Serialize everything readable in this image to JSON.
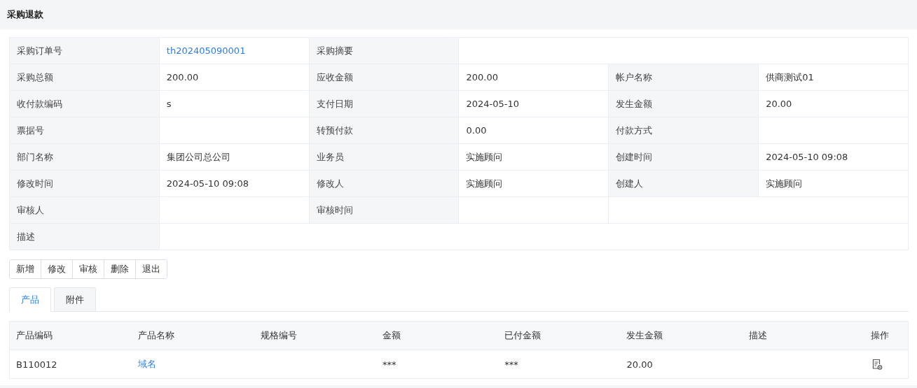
{
  "page": {
    "title": "采购退款"
  },
  "details": [
    [
      {
        "kind": "label",
        "text": "采购订单号"
      },
      {
        "kind": "link",
        "text": "th202405090001"
      },
      {
        "kind": "label",
        "text": "采购摘要"
      },
      {
        "kind": "value"
      }
    ],
    [
      {
        "kind": "label",
        "text": "采购总额"
      },
      {
        "kind": "value",
        "text": "200.00"
      },
      {
        "kind": "label",
        "text": "应收金额"
      },
      {
        "kind": "value",
        "text": "200.00"
      },
      {
        "kind": "label",
        "text": "帐户名称"
      },
      {
        "kind": "value",
        "text": "供商测试01"
      }
    ],
    [
      {
        "kind": "label",
        "text": "收付款编码"
      },
      {
        "kind": "value",
        "text": "s"
      },
      {
        "kind": "label",
        "text": "支付日期"
      },
      {
        "kind": "value",
        "text": "2024-05-10"
      },
      {
        "kind": "label",
        "text": "发生金额"
      },
      {
        "kind": "value",
        "text": "20.00"
      }
    ],
    [
      {
        "kind": "label",
        "text": "票据号"
      },
      {
        "kind": "value"
      },
      {
        "kind": "label",
        "text": "转预付款"
      },
      {
        "kind": "value",
        "text": "0.00"
      },
      {
        "kind": "label",
        "text": "付款方式"
      },
      {
        "kind": "value"
      }
    ],
    [
      {
        "kind": "label",
        "text": "部门名称"
      },
      {
        "kind": "value",
        "text": "集团公司总公司"
      },
      {
        "kind": "label",
        "text": "业务员"
      },
      {
        "kind": "value",
        "text": "实施顾问"
      },
      {
        "kind": "label",
        "text": "创建时间"
      },
      {
        "kind": "value",
        "text": "2024-05-10 09:08"
      }
    ],
    [
      {
        "kind": "label",
        "text": "修改时间"
      },
      {
        "kind": "value",
        "text": "2024-05-10 09:08"
      },
      {
        "kind": "label",
        "text": "修改人"
      },
      {
        "kind": "value",
        "text": "实施顾问"
      },
      {
        "kind": "label",
        "text": "创建人"
      },
      {
        "kind": "value",
        "text": "实施顾问"
      }
    ],
    [
      {
        "kind": "label",
        "text": "审核人"
      },
      {
        "kind": "value"
      },
      {
        "kind": "label",
        "text": "审核时间"
      },
      {
        "kind": "value"
      },
      {
        "kind": "empty"
      }
    ],
    [
      {
        "kind": "label",
        "text": "描述"
      },
      {
        "kind": "value"
      }
    ]
  ],
  "buttons": [
    "新增",
    "修改",
    "审核",
    "删除",
    "退出"
  ],
  "tabs": [
    {
      "label": "产品",
      "selected": true
    },
    {
      "label": "附件",
      "selected": false
    }
  ],
  "table": {
    "columns": [
      "产品编码",
      "产品名称",
      "规格编号",
      "金额",
      "已付金额",
      "发生金额",
      "描述",
      "操作"
    ],
    "rows": [
      [
        {
          "kind": "text",
          "text": "B110012"
        },
        {
          "kind": "link",
          "text": "域名"
        },
        {
          "kind": "text"
        },
        {
          "kind": "text",
          "text": "***"
        },
        {
          "kind": "text",
          "text": "***"
        },
        {
          "kind": "text",
          "text": "20.00"
        },
        {
          "kind": "text"
        },
        {
          "kind": "view-action"
        }
      ]
    ]
  }
}
